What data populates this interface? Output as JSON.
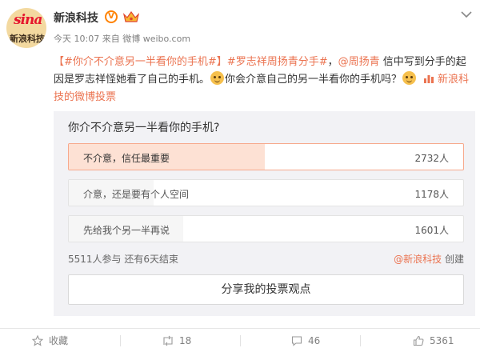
{
  "author": {
    "name": "新浪科技",
    "avatar_text_1": "sina",
    "avatar_text_2": "新浪科技",
    "verified_mark": "V"
  },
  "post": {
    "time": "今天 10:07",
    "source_prefix": "来自",
    "source": "微博 weibo.com",
    "topic1": "【#你介不介意另一半看你的手机#】",
    "topic2": "#罗志祥周扬青分手#",
    "comma": "，",
    "mention": "@周扬青",
    "text1": " 信中写到分手的起因是罗志祥怪她看了自己的手机。",
    "text2": "你会介意自己的另一半看你的手机吗？",
    "vote_link": "新浪科技的微博投票"
  },
  "poll": {
    "question": "你介不介意另一半看你的手机?",
    "options": [
      {
        "label": "不介意，信任最重要",
        "count": "2732人",
        "fraction": 0.496,
        "selected": true
      },
      {
        "label": "介意，还是要有个人空间",
        "count": "1178人",
        "fraction": 0.214,
        "selected": false
      },
      {
        "label": "先给我个另一半再说",
        "count": "1601人",
        "fraction": 0.291,
        "selected": false
      }
    ],
    "participants": "5511人参与",
    "remaining": "还有6天结束",
    "creator": "@新浪科技",
    "creator_suffix": " 创建",
    "share_label": "分享我的投票观点"
  },
  "actions": {
    "favorite": "收藏",
    "repost": "18",
    "comment": "46",
    "like": "5361"
  },
  "colors": {
    "link": "#eb7350",
    "selected_fill": "#fde1d4",
    "brand_red": "#e6162d",
    "verified": "#ff8200"
  },
  "icons": [
    "chevron-down-icon",
    "verified-icon",
    "crown-icon",
    "emoji-doge-icon",
    "emoji-smile-icon",
    "vote-icon",
    "star-icon",
    "repost-icon",
    "comment-icon",
    "like-icon"
  ]
}
